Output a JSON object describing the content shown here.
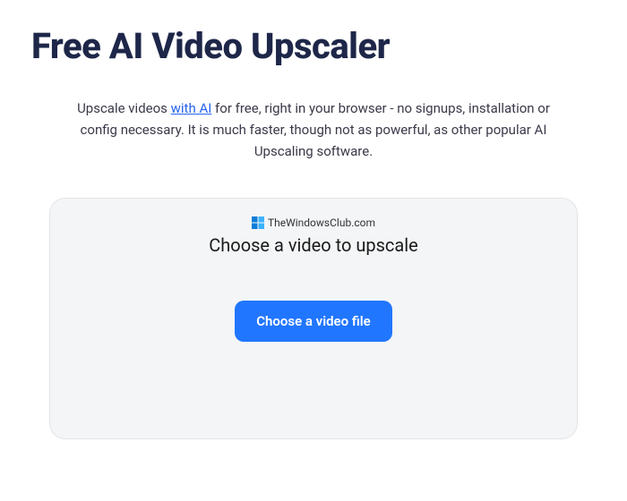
{
  "header": {
    "title": "Free AI Video Upscaler"
  },
  "description": {
    "prefix": "Upscale videos ",
    "link_text": "with AI",
    "suffix": " for free, right in your browser - no signups, installation or config necessary. It is much faster, though not as powerful, as other popular AI Upscaling software."
  },
  "upload_card": {
    "watermark_text": "TheWindowsClub.com",
    "title": "Choose a video to upscale",
    "button_label": "Choose a video file"
  }
}
